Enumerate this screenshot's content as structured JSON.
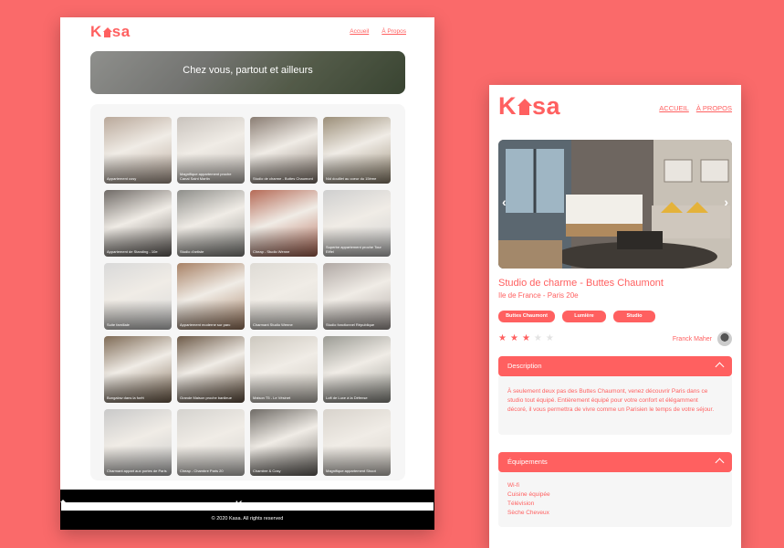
{
  "brand": {
    "accent": "#ff6060",
    "logo_left": "K",
    "logo_right": "sa"
  },
  "desktop": {
    "nav": [
      "Accueil",
      "À Propos"
    ],
    "hero_title": "Chez vous, partout et ailleurs",
    "cards": [
      {
        "title": "Appartement cosy",
        "color": "#b9a89a"
      },
      {
        "title": "Magnifique appartement proche Canal Saint Martin",
        "color": "#c9c3bd"
      },
      {
        "title": "Studio de charme - Buttes Chaumont",
        "color": "#8a7d73"
      },
      {
        "title": "Nid douillet au coeur du 15ème",
        "color": "#9b8e78"
      },
      {
        "title": "Appartement de Standing - 10e",
        "color": "#6f6a66"
      },
      {
        "title": "Studio d'artiste",
        "color": "#8e8e8a"
      },
      {
        "title": "Cheap - Studio Wenne",
        "color": "#b56a56"
      },
      {
        "title": "Superbe appartement proche Tour Eiffel",
        "color": "#cfcfcf"
      },
      {
        "title": "Suite familiale",
        "color": "#d9d9d9"
      },
      {
        "title": "Appartement moderne sur parc",
        "color": "#a88266"
      },
      {
        "title": "Charmant Studio Wenne",
        "color": "#dedbd5"
      },
      {
        "title": "Studio fonctionnel République",
        "color": "#b0a8a4"
      },
      {
        "title": "Bungalow dans la forêt",
        "color": "#7e6a55"
      },
      {
        "title": "Grande Maison proche banlieue",
        "color": "#6d5a48"
      },
      {
        "title": "Maison T5 - Le Vésinet",
        "color": "#cdc8bf"
      },
      {
        "title": "Loft de Luxe à la Défense",
        "color": "#9b9b94"
      },
      {
        "title": "Charmant appart aux portes de Paris",
        "color": "#c9c9c9"
      },
      {
        "title": "Cheap - Chambre Paris 20",
        "color": "#d5d3cf"
      },
      {
        "title": "Chambre & Cosy",
        "color": "#6f6b66"
      },
      {
        "title": "Magnifique appartement Shoot",
        "color": "#d8d3cc"
      }
    ],
    "footer": {
      "copyright": "© 2020 Kasa. All rights reserved"
    }
  },
  "mobile": {
    "nav": [
      "ACCUEIL",
      "À PROPOS"
    ],
    "arrow_left": "‹",
    "arrow_right": "›",
    "title": "Studio de charme - Buttes Chaumont",
    "location": "Ile de France - Paris 20e",
    "tags": [
      "Buttes Chaumont",
      "Lumière",
      "Studio"
    ],
    "rating": 3,
    "rating_max": 5,
    "star_glyph": "★",
    "host": "Franck Maher",
    "description": {
      "label": "Description",
      "text": "À seulement deux pas des Buttes Chaumont, venez découvrir Paris dans ce studio tout équipé. Entièrement équipé pour votre confort et élégamment décoré, il vous permettra de vivre comme un Parisien le temps de votre séjour."
    },
    "equipments": {
      "label": "Équipements",
      "items": [
        "Wi-fi",
        "Cuisine équipée",
        "Télévision",
        "Sèche Cheveux"
      ]
    }
  }
}
